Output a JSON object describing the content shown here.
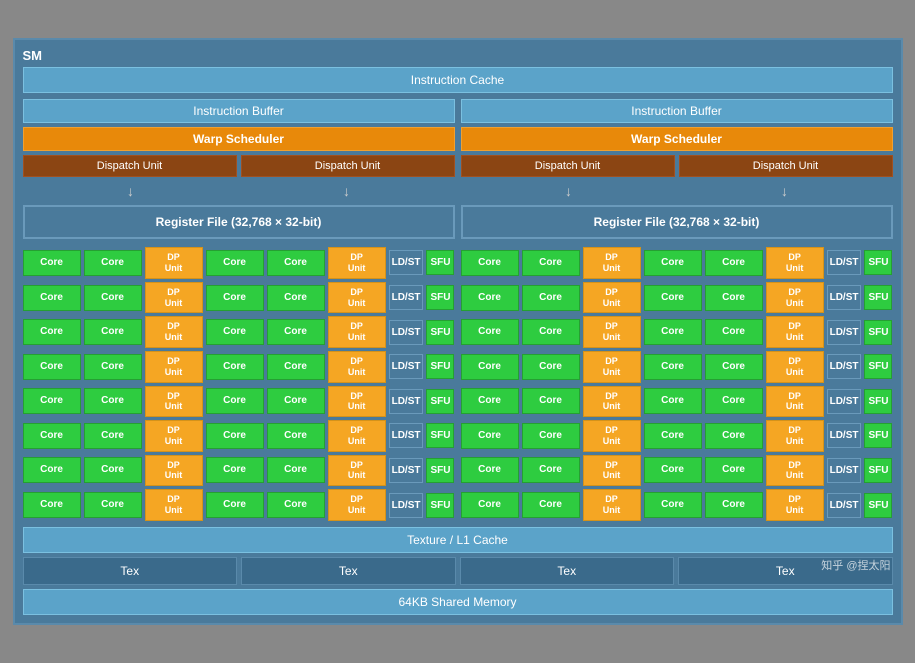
{
  "sm": {
    "label": "SM",
    "instruction_cache": "Instruction Cache",
    "left_half": {
      "instruction_buffer": "Instruction Buffer",
      "warp_scheduler": "Warp Scheduler",
      "dispatch_unit_1": "Dispatch Unit",
      "dispatch_unit_2": "Dispatch Unit",
      "register_file": "Register File (32,768 × 32-bit)"
    },
    "right_half": {
      "instruction_buffer": "Instruction Buffer",
      "warp_scheduler": "Warp Scheduler",
      "dispatch_unit_1": "Dispatch Unit",
      "dispatch_unit_2": "Dispatch Unit",
      "register_file": "Register File (32,768 × 32-bit)"
    },
    "texture_l1_cache": "Texture / L1 Cache",
    "tex_labels": [
      "Tex",
      "Tex",
      "Tex",
      "Tex"
    ],
    "shared_memory": "64KB Shared Memory",
    "watermark": "知乎 @捏太阳",
    "rows": 8,
    "core_label": "Core",
    "dp_unit_label": "DP\nUnit",
    "ldst_label": "LD/ST",
    "sfu_label": "SFU"
  }
}
